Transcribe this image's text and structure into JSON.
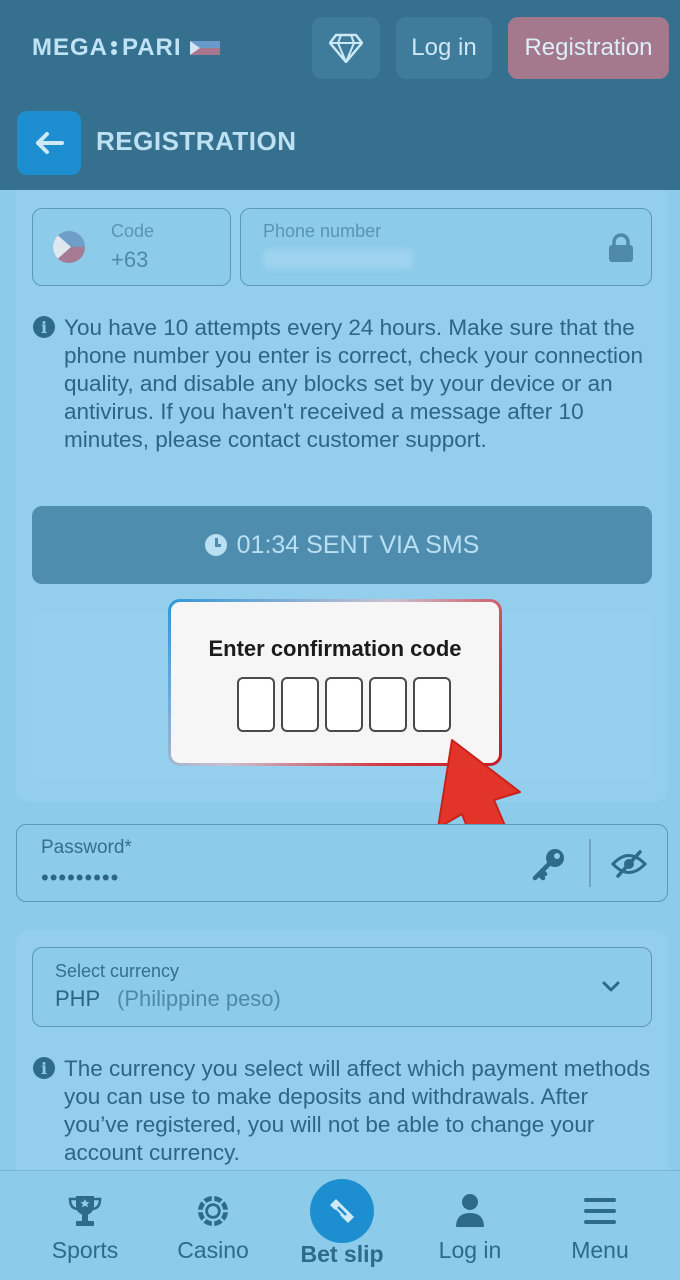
{
  "header": {
    "logo_text_left": "MEGA",
    "logo_text_right": "PARI",
    "login_label": "Log in",
    "registration_label": "Registration"
  },
  "subheader": {
    "title": "REGISTRATION"
  },
  "phone": {
    "code_label": "Code",
    "code_value": "+63",
    "number_label": "Phone number"
  },
  "info1": "You have 10 attempts every 24 hours. Make sure that the phone number you enter is correct, check your connection quality, and disable any blocks set by your device or an antivirus. If you haven't received a message after 10 minutes, please contact customer support.",
  "sms_button": "01:34 SENT VIA SMS",
  "modal": {
    "title": "Enter confirmation code"
  },
  "password": {
    "label": "Password*",
    "value": "•••••••••"
  },
  "currency": {
    "label": "Select currency",
    "code": "PHP",
    "name": "(Philippine peso)"
  },
  "info2": "The currency you select will affect which payment methods you can use to make deposits and withdrawals. After you’ve registered, you will not be able to change your account currency.",
  "nav": {
    "sports": "Sports",
    "casino": "Casino",
    "betslip": "Bet slip",
    "login": "Log in",
    "menu": "Menu"
  },
  "colors": {
    "accent": "#1d8fd1",
    "header_bg": "#35708f",
    "page_bg": "#8ccbea",
    "arrow": "#e3342a"
  }
}
